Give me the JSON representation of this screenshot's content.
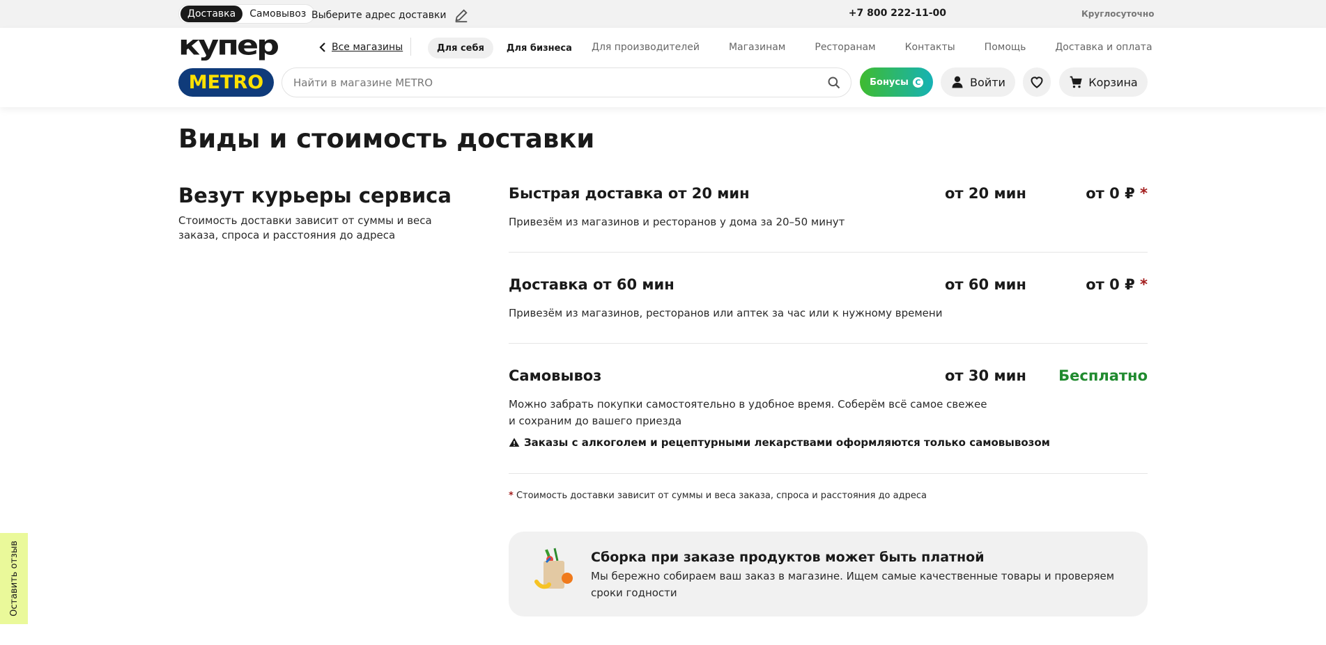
{
  "topbar": {
    "modes": [
      "Доставка",
      "Самовывоз"
    ],
    "active_mode": "Доставка",
    "address_label": "Выберите адрес доставки",
    "phone": "+7 800 222-11-00",
    "hours": "Круглосуточно"
  },
  "header": {
    "logo": "купер",
    "all_stores": "Все магазины",
    "segments": [
      "Для себя",
      "Для бизнеса"
    ],
    "nav": [
      "Для производителей",
      "Магазинам",
      "Ресторанам",
      "Контакты",
      "Помощь",
      "Доставка и оплата"
    ],
    "store": "METRO",
    "search_placeholder": "Найти в магазине METRO",
    "bonus": "Бонусы",
    "bonus_symbol": "С",
    "login": "Войти",
    "cart": "Корзина"
  },
  "page": {
    "title": "Виды и стоимость доставки",
    "left_title": "Везут курьеры сервиса",
    "left_desc": "Стоимость доставки зависит от суммы и веса заказа, спроса и расстояния до адреса"
  },
  "delivery_options": [
    {
      "title": "Быстрая доставка от 20 мин",
      "time": "от 20 мин",
      "price": "от 0 ₽",
      "asterisk": "*",
      "desc": "Привезём из магазинов и ресторанов у дома за 20–50 минут"
    },
    {
      "title": "Доставка от 60 мин",
      "time": "от 60 мин",
      "price": "от 0 ₽",
      "asterisk": "*",
      "desc": "Привезём из магазинов, ресторанов или аптек за час или к нужному времени"
    },
    {
      "title": "Самовывоз",
      "time": "от 30 мин",
      "price": "Бесплатно",
      "desc": "Можно забрать покупки самостоятельно в удобное время. Соберём всё самое свежее и сохраним до вашего приезда",
      "warning": "Заказы с алкоголем и рецептурными лекарствами оформляются только самовывозом"
    }
  ],
  "footnote": {
    "asterisk": "*",
    "text": "Стоимость доставки зависит от суммы и веса заказа, спроса и расстояния до адреса"
  },
  "info": {
    "title": "Сборка при заказе продуктов может быть платной",
    "desc": "Мы бережно собираем ваш заказ в магазине. Ищем самые качественные товары и проверяем сроки годности"
  },
  "feedback": "Оставить отзыв",
  "colors": {
    "price_free": "#1f8a2e",
    "asterisk": "#a31d1d",
    "store_badge": "#0f3b7a",
    "store_text": "#ffe100",
    "feedback_bg": "#eaf99a"
  }
}
